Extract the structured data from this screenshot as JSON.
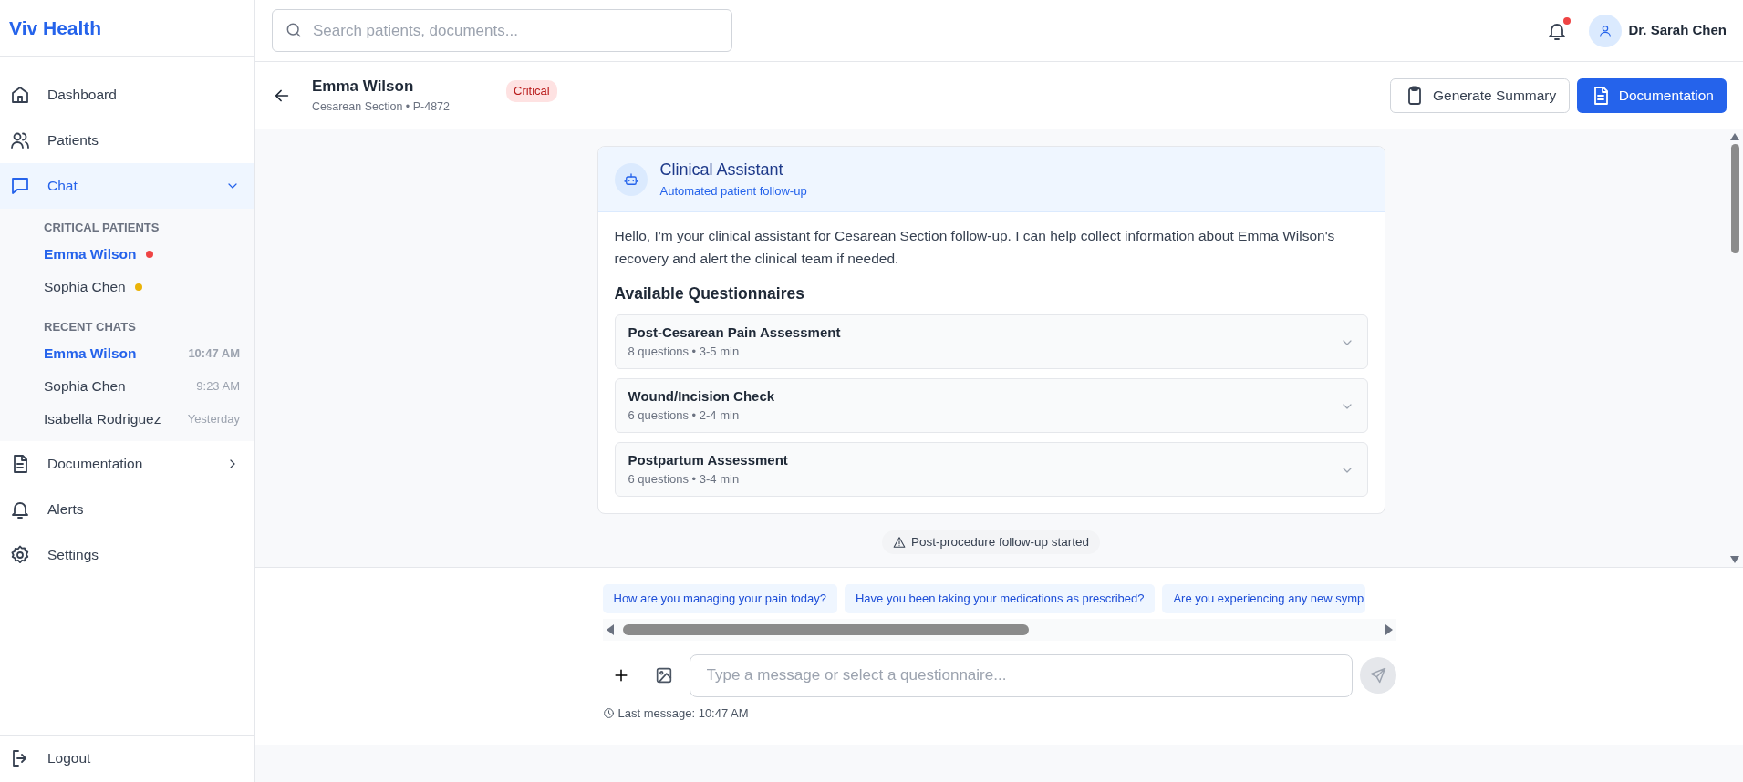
{
  "brand": "Viv Health",
  "sidebar": {
    "items": [
      {
        "kind": "link",
        "label": "Dashboard",
        "selected": false
      },
      {
        "kind": "link",
        "label": "Patients",
        "selected": false
      },
      {
        "kind": "group",
        "label": "Chat",
        "selected": true,
        "expanded": true,
        "sections": [
          {
            "title": "CRITICAL PATIENTS",
            "kind": "dots",
            "items": [
              {
                "name": "Emma Wilson",
                "selected": true,
                "color": "#ef4444"
              },
              {
                "name": "Sophia Chen",
                "selected": false,
                "color": "#eab308"
              }
            ]
          },
          {
            "title": "RECENT CHATS",
            "kind": "times",
            "items": [
              {
                "name": "Emma Wilson",
                "selected": true,
                "time": "10:47 AM"
              },
              {
                "name": "Sophia Chen",
                "selected": false,
                "time": "9:23 AM"
              },
              {
                "name": "Isabella Rodriguez",
                "selected": false,
                "time": "Yesterday"
              }
            ]
          }
        ]
      },
      {
        "kind": "group",
        "label": "Documentation",
        "selected": false,
        "expanded": false
      },
      {
        "kind": "link",
        "label": "Alerts",
        "selected": false
      },
      {
        "kind": "link",
        "label": "Settings",
        "selected": false
      }
    ],
    "logout": "Logout"
  },
  "topbar": {
    "search": {
      "placeholder": "Search patients, documents..."
    },
    "notifications_unread": true,
    "user": "Dr. Sarah Chen"
  },
  "patient": {
    "name": "Emma Wilson",
    "details": "Cesarean Section • P-4872",
    "status": "Critical",
    "actions": [
      {
        "label": "Generate Summary",
        "kind": "outline"
      },
      {
        "label": "Documentation",
        "kind": "primary"
      }
    ]
  },
  "assistant": {
    "title": "Clinical Assistant",
    "subtitle": "Automated patient follow-up",
    "message": "Hello, I'm your clinical assistant for Cesarean Section follow-up. I can help collect information about Emma Wilson's recovery and alert the clinical team if needed.",
    "questionnaires_title": "Available Questionnaires",
    "questionnaires": [
      {
        "title": "Post-Cesarean Pain Assessment",
        "meta": "8 questions • 3-5 min",
        "expanded": false
      },
      {
        "title": "Wound/Incision Check",
        "meta": "6 questions • 2-4 min",
        "expanded": false
      },
      {
        "title": "Postpartum Assessment",
        "meta": "6 questions • 3-4 min",
        "expanded": false
      }
    ]
  },
  "system_notice": "Post-procedure follow-up started",
  "suggestions": [
    "How are you managing your pain today?",
    "Have you been taking your medications as prescribed?",
    "Are you experiencing any new symp"
  ],
  "composer": {
    "placeholder": "Type a message or select a questionnaire...",
    "last_message": "Last message: 10:47 AM"
  }
}
